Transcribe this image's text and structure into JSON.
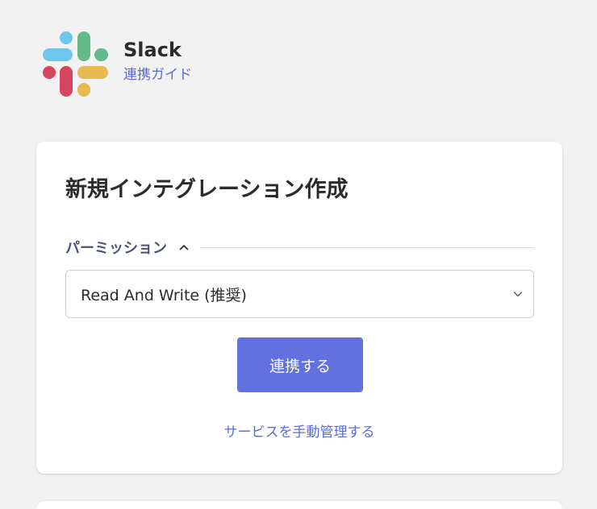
{
  "header": {
    "app_name": "Slack",
    "guide_link": "連携ガイド",
    "logo": "slack-logo"
  },
  "card": {
    "title": "新規インテグレーション作成",
    "permission_section": {
      "label": "パーミッション",
      "expanded": true,
      "toggle_icon": "chevron-up-icon"
    },
    "permission_select": {
      "selected_value": "Read And Write (推奨)",
      "icon": "chevron-down-icon"
    },
    "connect_button_label": "連携する",
    "manual_manage_link": "サービスを手動管理する"
  },
  "colors": {
    "background": "#f2f2f2",
    "card": "#ffffff",
    "accent": "#6171df",
    "link": "#5a6bd8",
    "section_label": "#4b5378",
    "slack_blue": "#36c5f0",
    "slack_green": "#2eb67d",
    "slack_red": "#e01e5a",
    "slack_yellow": "#ecb22e"
  }
}
